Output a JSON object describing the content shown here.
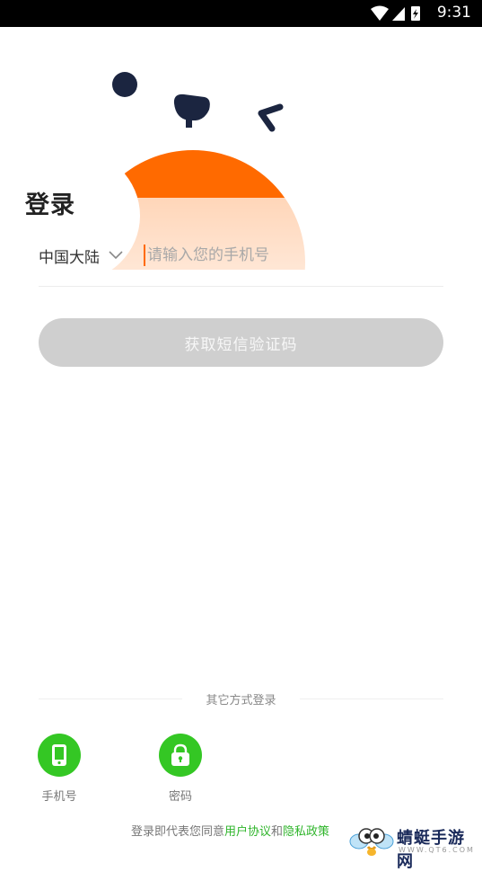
{
  "status_bar": {
    "time": "9:31"
  },
  "login": {
    "title": "登录",
    "region": "中国大陆",
    "phone_placeholder": "请输入您的手机号",
    "sms_button": "获取短信验证码"
  },
  "other_login": {
    "heading": "其它方式登录",
    "options": [
      {
        "label": "手机号",
        "icon": "phone-icon"
      },
      {
        "label": "密码",
        "icon": "lock-icon"
      }
    ]
  },
  "agreement": {
    "prefix": "登录即代表您同意",
    "user_agreement": "用户协议",
    "and": "和",
    "privacy_policy": "隐私政策"
  },
  "watermark": {
    "name": "蜻蜓手游网",
    "site": "WWW.QT6.COM"
  },
  "colors": {
    "accent": "#ff6a00",
    "green": "#34c724",
    "link_green": "#2fb52b",
    "dark": "#1b2540"
  }
}
